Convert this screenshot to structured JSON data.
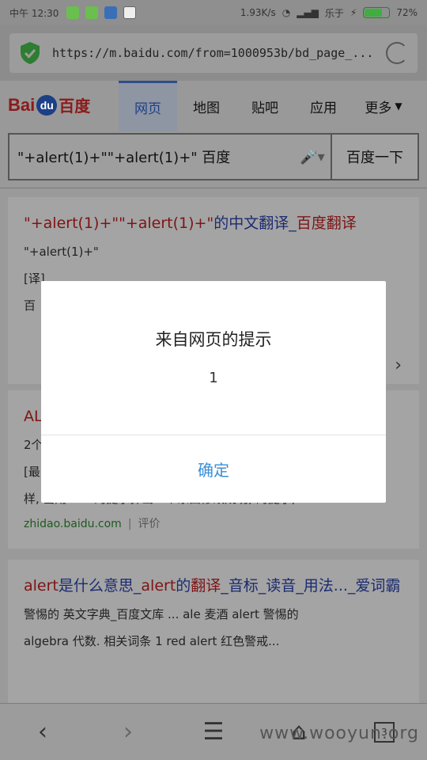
{
  "status_bar": {
    "time": "中午 12:30",
    "speed": "1.93K/s",
    "carrier": "乐于",
    "battery_level": 0.72,
    "battery_text": "72%"
  },
  "address_bar": {
    "url": "https://m.baidu.com/from=1000953b/bd_page_...",
    "security_color": "#2e7d32"
  },
  "header": {
    "logo_text": "Bai",
    "logo_du": "du",
    "logo_cn": "百度",
    "tabs": [
      {
        "label": "网页",
        "active": true
      },
      {
        "label": "地图"
      },
      {
        "label": "贴吧"
      },
      {
        "label": "应用"
      },
      {
        "label": "更多"
      }
    ],
    "search_query": "\"+alert(1)+\"\"+alert(1)+\" 百度",
    "search_button": "百度一下"
  },
  "results": [
    {
      "title_parts": [
        "\"+alert(1)+\"\"+alert(1)+\"",
        "的中文翻译_",
        "百度翻译"
      ],
      "snippet_lines": [
        "\"+alert(1)+\"",
        "[译] ...",
        "百"
      ]
    },
    {
      "title_parts": [
        "AL",
        ""
      ],
      "snippet_lines": [
        "2个",
        "[最",
        "样, 当用alert的提示弹出一个东西修改成功, 的提示,"
      ],
      "source": "zhidao.baidu.com",
      "source_extra": "评价"
    },
    {
      "title_parts": [
        "alert",
        "是什么意思_",
        "alert",
        "的",
        "翻译",
        "_音标_读音_用法..._爱词霸"
      ],
      "snippet_lines": [
        "警惕的 英文字典_百度文库 ... ale 麦酒 alert 警惕的",
        "algebra 代数. 相关词条 1 red alert 红色警戒..."
      ]
    }
  ],
  "dialog": {
    "title": "来自网页的提示",
    "message": "1",
    "ok_label": "确定"
  },
  "bottom_nav": {
    "tab_count": "3"
  },
  "watermark": "www.wooyun.org"
}
